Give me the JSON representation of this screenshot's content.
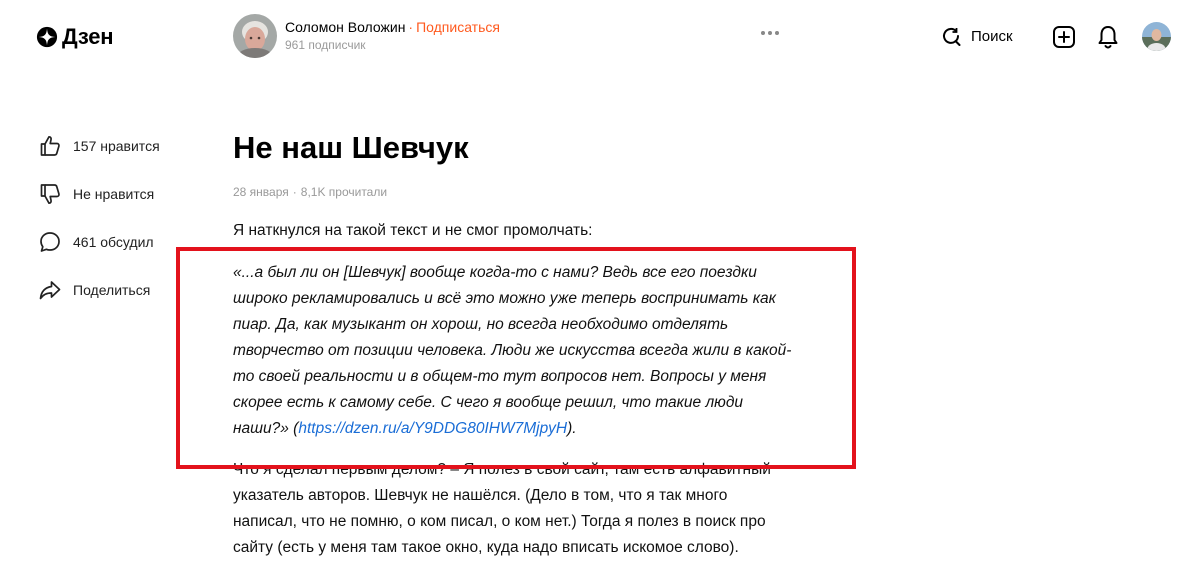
{
  "header": {
    "logo_text": "Дзен",
    "author_name": "Соломон Воложин",
    "author_separator": "·",
    "subscribe_label": "Подписаться",
    "subscribers": "961 подписчик",
    "search_label": "Поиск",
    "accent_color": "#ff5a1f"
  },
  "sidebar": {
    "items": [
      {
        "icon": "thumbs-up-icon",
        "label": "157 нравится"
      },
      {
        "icon": "thumbs-down-icon",
        "label": "Не нравится"
      },
      {
        "icon": "comment-icon",
        "label": "461 обсудил"
      },
      {
        "icon": "share-icon",
        "label": "Поделиться"
      }
    ]
  },
  "article": {
    "title": "Не наш Шевчук",
    "date": "28 января",
    "meta_separator": "·",
    "reads": "8,1K прочитали",
    "intro": "Я наткнулся на такой текст и не смог промолчать:",
    "quote_text": "«...а был ли он [Шевчук] вообще когда-то с нами? Ведь все его поездки широко рекламировались и всё это можно уже теперь воспринимать как пиар. Да, как музыкант он хорош, но всегда необходимо отделять творчество от позиции человека. Люди же искусства всегда жили в какой-то своей реальности и в общем-то тут вопросов нет. Вопросы у меня скорее есть к самому себе. С чего я вообще решил, что такие люди наши?» (",
    "quote_link": "https://dzen.ru/a/Y9DDG80IHW7MjpyH",
    "quote_end": ").",
    "body": "Что я сделал первым делом? – Я полез в свой сайт, там есть алфавитный указатель авторов. Шевчук не нашёлся. (Дело в том, что я так много написал, что не помню, о ком писал, о ком нет.) Тогда я полез в поиск про сайту (есть у меня там такое окно, куда надо вписать искомое слово).",
    "link_color": "#1a6dd6",
    "highlight_color": "#e3121c"
  }
}
